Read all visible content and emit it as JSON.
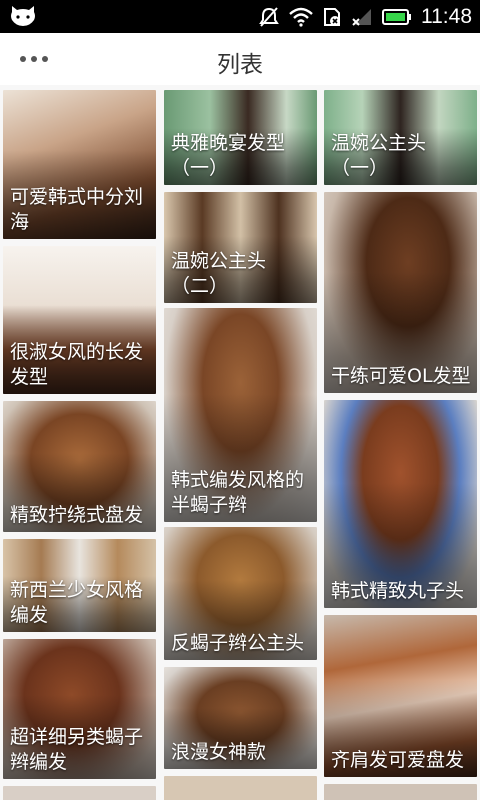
{
  "status_bar": {
    "time": "11:48",
    "icons": [
      "cat-icon",
      "mute-icon",
      "wifi-icon",
      "sim-icon",
      "signal-icon",
      "battery-icon"
    ],
    "battery_color": "#37d64a"
  },
  "header": {
    "menu_icon": "more-dots-icon",
    "title": "列表"
  },
  "items": [
    {
      "title": "可爱韩式中分刘海"
    },
    {
      "title": "典雅晚宴发型（一）"
    },
    {
      "title": "温婉公主头（一）"
    },
    {
      "title": "温婉公主头（二）"
    },
    {
      "title": "很淑女风的长发发型"
    },
    {
      "title": "干练可爱OL发型"
    },
    {
      "title": "韩式编发风格的半蝎子辫"
    },
    {
      "title": "精致拧绕式盘发"
    },
    {
      "title": "韩式精致丸子头"
    },
    {
      "title": "新西兰少女风格编发"
    },
    {
      "title": "反蝎子辫公主头"
    },
    {
      "title": "超详细另类蝎子辫编发"
    },
    {
      "title": "浪漫女神款"
    },
    {
      "title": "齐肩发可爱盘发"
    }
  ]
}
